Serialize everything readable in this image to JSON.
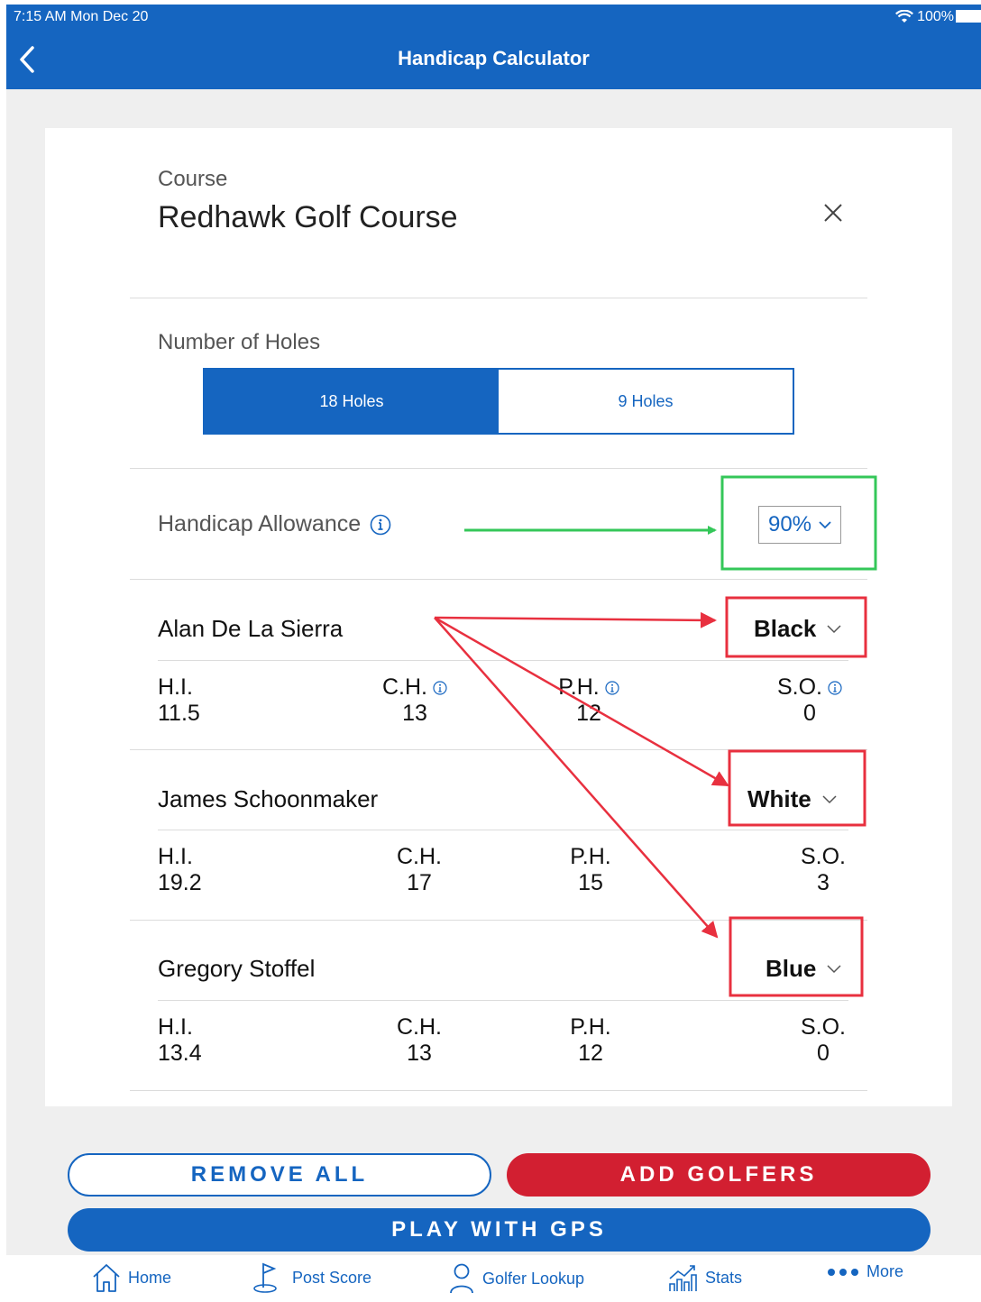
{
  "status_bar": {
    "time": "7:15 AM   Mon Dec 20",
    "battery": "100%"
  },
  "header": {
    "title": "Handicap Calculator"
  },
  "course": {
    "label": "Course",
    "name": "Redhawk Golf Course"
  },
  "holes": {
    "label": "Number of Holes",
    "options": [
      "18 Holes",
      "9 Holes"
    ],
    "selected": "18 Holes"
  },
  "allowance": {
    "label": "Handicap Allowance",
    "value": "90%"
  },
  "stat_labels": {
    "hi": "H.I.",
    "ch": "C.H.",
    "ph": "P.H.",
    "so": "S.O."
  },
  "golfers": [
    {
      "name": "Alan De La Sierra",
      "tee": "Black",
      "hi": "11.5",
      "ch": "13",
      "ph": "12",
      "so": "0"
    },
    {
      "name": "James Schoonmaker",
      "tee": "White",
      "hi": "19.2",
      "ch": "17",
      "ph": "15",
      "so": "3"
    },
    {
      "name": "Gregory Stoffel",
      "tee": "Blue",
      "hi": "13.4",
      "ch": "13",
      "ph": "12",
      "so": "0"
    }
  ],
  "actions": {
    "remove_all": "REMOVE ALL",
    "add_golfers": "ADD GOLFERS",
    "play_gps": "PLAY WITH GPS"
  },
  "tabs": [
    {
      "label": "Home",
      "icon": "home-icon"
    },
    {
      "label": "Post Score",
      "icon": "golf-flag-icon"
    },
    {
      "label": "Golfer Lookup",
      "icon": "person-icon"
    },
    {
      "label": "Stats",
      "icon": "chart-icon"
    },
    {
      "label": "More",
      "icon": "dots-icon"
    }
  ],
  "colors": {
    "primary": "#1565c0",
    "danger": "#d21f31",
    "annotation_green": "#34c759",
    "annotation_red": "#e8303f"
  }
}
